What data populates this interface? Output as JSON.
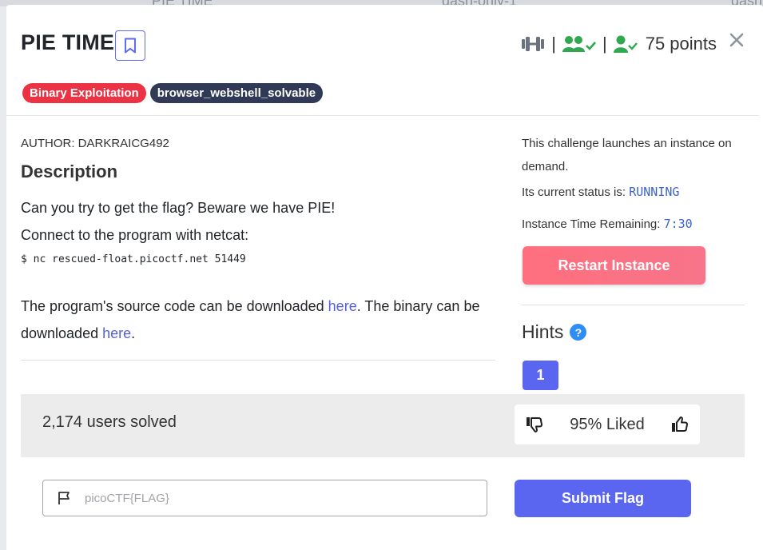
{
  "backdrop": {
    "items": [
      "PIE TIME",
      "dash-only-1",
      "dash"
    ]
  },
  "challenge": {
    "title": "PIE TIME",
    "points": "75 points",
    "tags": [
      "Binary Exploitation",
      "browser_webshell_solvable"
    ],
    "author": "AUTHOR: DARKRAICG492",
    "description_heading": "Description",
    "description_line1": "Can you try to get the flag? Beware we have PIE!",
    "description_line2": "Connect to the program with netcat:",
    "command": "$ nc rescued-float.picoctf.net 51449",
    "source_text_1": "The program's source code can be downloaded ",
    "source_link": "here",
    "source_text_2": ". The binary can be downloaded ",
    "binary_link": "here",
    "source_text_3": "."
  },
  "instance": {
    "launch_text": "This challenge launches an instance on demand.",
    "status_label": "Its current status is: ",
    "status_value": "RUNNING",
    "time_label": "Instance Time Remaining: ",
    "time_value": "7:30",
    "restart_label": "Restart Instance"
  },
  "hints": {
    "heading": "Hints",
    "help_icon": "?",
    "items": [
      "1"
    ]
  },
  "stats": {
    "solved": "2,174 users solved",
    "liked": "95% Liked"
  },
  "flag_form": {
    "placeholder": "picoCTF{FLAG}",
    "submit_label": "Submit Flag"
  },
  "icons": {
    "bookmark": "bookmark-icon",
    "difficulty": "dumbbell-icon",
    "users": "users-check-icon",
    "user": "user-check-icon",
    "close": "close-icon",
    "thumbs_down": "thumbs-down-icon",
    "thumbs_up": "thumbs-up-icon",
    "flag": "flag-icon"
  },
  "colors": {
    "accent": "#5b66f0",
    "red_tag": "#ec3344",
    "dark_tag": "#303a56",
    "green": "#2fa84f",
    "restart_pink": "#ff6f7e"
  }
}
